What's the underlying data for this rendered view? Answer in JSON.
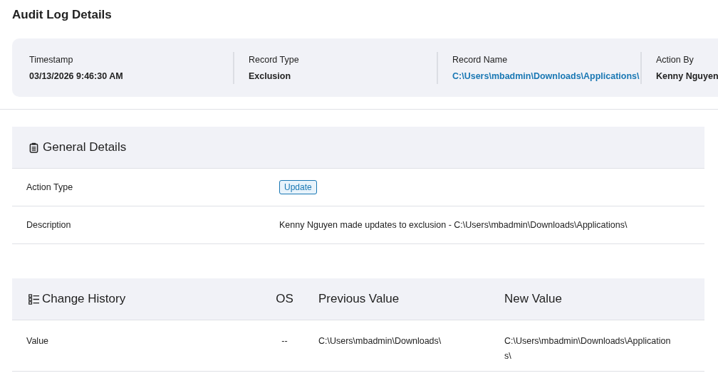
{
  "page_title": "Audit Log Details",
  "summary": [
    {
      "label": "Timestamp",
      "value": "03/13/2026 9:46:30 AM",
      "kind": "text"
    },
    {
      "label": "Record Type",
      "value": "Exclusion",
      "kind": "text"
    },
    {
      "label": "Record Name",
      "value": "C:\\Users\\mbadmin\\Downloads\\Applications\\",
      "kind": "link"
    },
    {
      "label": "Action By",
      "value": "Kenny Nguyen",
      "kind": "text"
    }
  ],
  "general_details": {
    "title": "General Details",
    "rows": [
      {
        "label": "Action Type",
        "value": "Update",
        "kind": "badge"
      },
      {
        "label": "Description",
        "value": "Kenny Nguyen made updates to exclusion - C:\\Users\\mbadmin\\Downloads\\Applications\\",
        "kind": "text"
      }
    ]
  },
  "change_history": {
    "title": "Change History",
    "columns": [
      "OS",
      "Previous Value",
      "New Value"
    ],
    "rows": [
      {
        "field": "Value",
        "os": "--",
        "previous": "C:\\Users\\mbadmin\\Downloads\\",
        "new": "C:\\Users\\mbadmin\\Downloads\\Applications\\"
      }
    ]
  }
}
